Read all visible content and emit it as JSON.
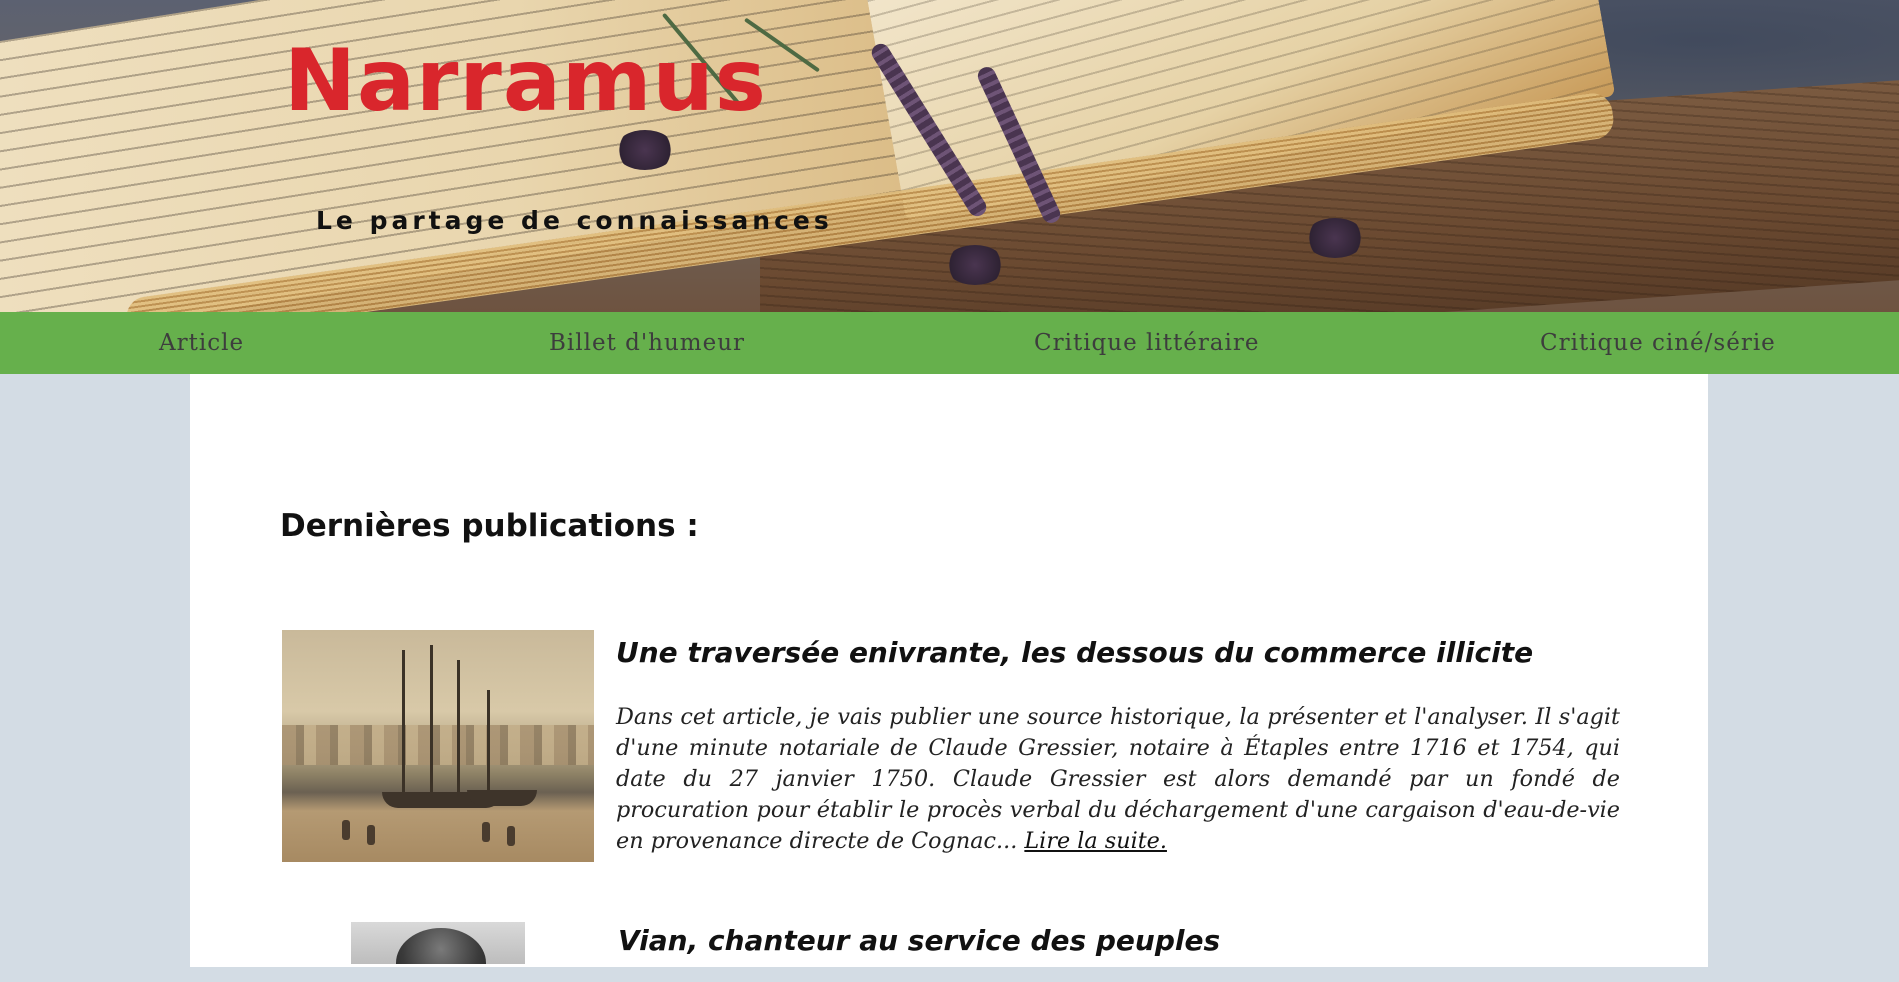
{
  "header": {
    "title": "Narramus",
    "subtitle": "Le partage de connaissances"
  },
  "nav": {
    "items": [
      {
        "label": "Article"
      },
      {
        "label": "Billet d'humeur"
      },
      {
        "label": "Critique littéraire"
      },
      {
        "label": "Critique ciné/série"
      }
    ]
  },
  "main": {
    "section_title": "Dernières publications :",
    "posts": [
      {
        "title": "Une traversée enivrante, les dessous du commerce illicite",
        "excerpt": "Dans cet article, je vais publier une source historique, la présenter et l'analyser. Il s'agit d'une minute notariale de Claude Gressier, notaire à Étaples entre 1716 et 1754, qui date du 27 janvier 1750. Claude Gressier est alors demandé par un fondé de procuration pour établir le procès verbal du déchargement d'une cargaison d'eau-de-vie en provenance directe de Cognac...",
        "read_more": "Lire la suite."
      },
      {
        "title": "Vian, chanteur au service des peuples"
      }
    ]
  },
  "colors": {
    "title_red": "#d9262c",
    "nav_green": "#66b04c",
    "page_bg": "#d3dce4"
  }
}
